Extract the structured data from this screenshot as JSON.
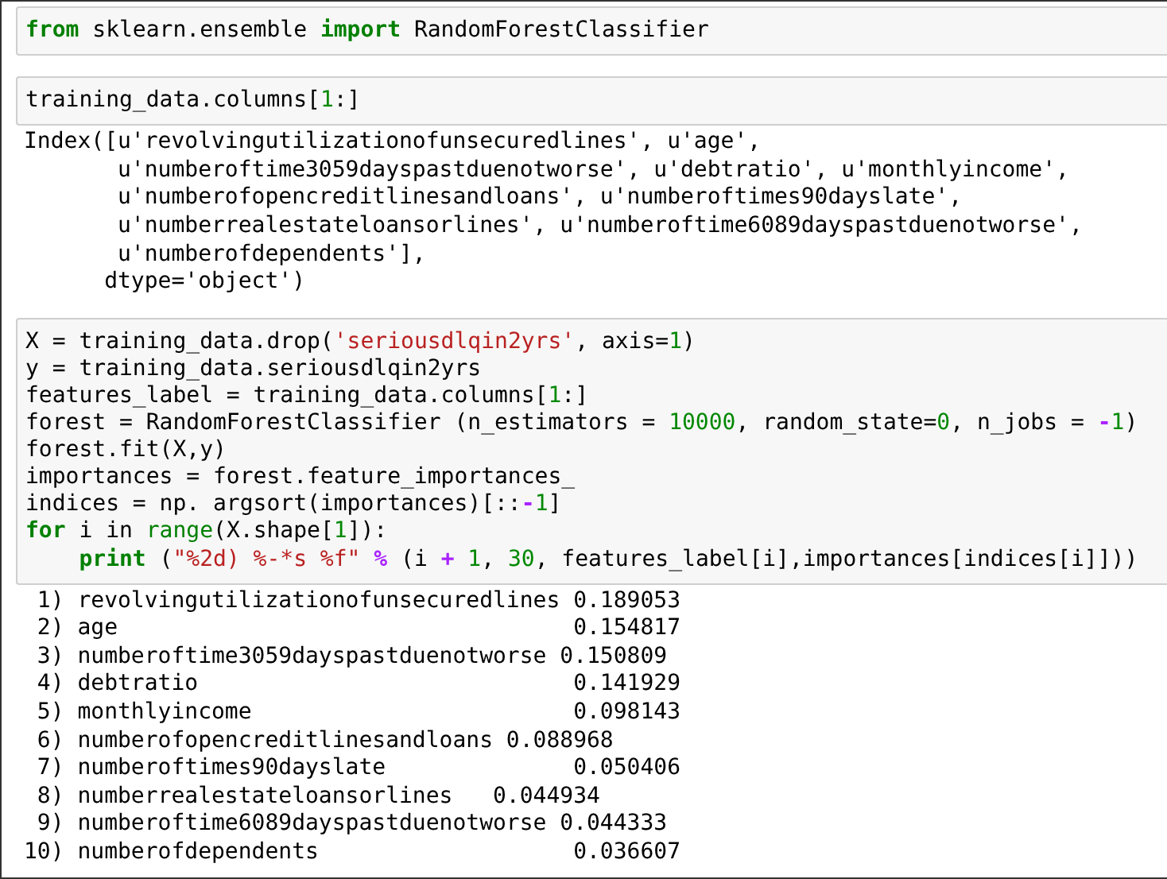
{
  "cells": [
    {
      "input": [
        [
          {
            "kind": "keyword",
            "text": "from"
          },
          {
            "kind": "plain",
            "text": " sklearn.ensemble "
          },
          {
            "kind": "keyword",
            "text": "import"
          },
          {
            "kind": "plain",
            "text": " RandomForestClassifier"
          }
        ]
      ]
    },
    {
      "input": [
        [
          {
            "kind": "plain",
            "text": "training_data.columns["
          },
          {
            "kind": "number",
            "text": "1"
          },
          {
            "kind": "plain",
            "text": ":]"
          }
        ]
      ],
      "output": [
        "Index([u'revolvingutilizationofunsecuredlines', u'age',",
        "       u'numberoftime3059dayspastduenotworse', u'debtratio', u'monthlyincome',",
        "       u'numberofopencreditlinesandloans', u'numberoftimes90dayslate',",
        "       u'numberrealestateloansorlines', u'numberoftime6089dayspastduenotworse',",
        "       u'numberofdependents'],",
        "      dtype='object')"
      ]
    },
    {
      "input": [
        [
          {
            "kind": "plain",
            "text": "X = training_data.drop("
          },
          {
            "kind": "string",
            "text": "'seriousdlqin2yrs'"
          },
          {
            "kind": "plain",
            "text": ", axis="
          },
          {
            "kind": "number",
            "text": "1"
          },
          {
            "kind": "plain",
            "text": ")"
          }
        ],
        [
          {
            "kind": "plain",
            "text": "y = training_data.seriousdlqin2yrs"
          }
        ],
        [
          {
            "kind": "plain",
            "text": "features_label = training_data.columns["
          },
          {
            "kind": "number",
            "text": "1"
          },
          {
            "kind": "plain",
            "text": ":]"
          }
        ],
        [
          {
            "kind": "plain",
            "text": "forest = RandomForestClassifier (n_estimators = "
          },
          {
            "kind": "number",
            "text": "10000"
          },
          {
            "kind": "plain",
            "text": ", random_state="
          },
          {
            "kind": "number",
            "text": "0"
          },
          {
            "kind": "plain",
            "text": ", n_jobs = "
          },
          {
            "kind": "operator",
            "text": "-"
          },
          {
            "kind": "number",
            "text": "1"
          },
          {
            "kind": "plain",
            "text": ")"
          }
        ],
        [
          {
            "kind": "plain",
            "text": "forest.fit(X,y)"
          }
        ],
        [
          {
            "kind": "plain",
            "text": "importances = forest.feature_importances_"
          }
        ],
        [
          {
            "kind": "plain",
            "text": "indices = np. argsort(importances)[::"
          },
          {
            "kind": "operator",
            "text": "-"
          },
          {
            "kind": "number",
            "text": "1"
          },
          {
            "kind": "plain",
            "text": "]"
          }
        ],
        [
          {
            "kind": "keyword",
            "text": "for"
          },
          {
            "kind": "plain",
            "text": " i in "
          },
          {
            "kind": "builtin",
            "text": "range"
          },
          {
            "kind": "plain",
            "text": "(X.shape["
          },
          {
            "kind": "number",
            "text": "1"
          },
          {
            "kind": "plain",
            "text": "]):"
          }
        ],
        [
          {
            "kind": "keyword",
            "text": "    print"
          },
          {
            "kind": "plain",
            "text": " ("
          },
          {
            "kind": "string",
            "text": "\"%2d) %-*s %f\""
          },
          {
            "kind": "operator",
            "text": " %"
          },
          {
            "kind": "plain",
            "text": " (i "
          },
          {
            "kind": "operator",
            "text": "+ "
          },
          {
            "kind": "number",
            "text": "1"
          },
          {
            "kind": "plain",
            "text": ", "
          },
          {
            "kind": "number",
            "text": "30"
          },
          {
            "kind": "plain",
            "text": ", features_label[i],importances[indices[i]]))"
          }
        ]
      ],
      "output": [
        " 1) revolvingutilizationofunsecuredlines 0.189053",
        " 2) age                                  0.154817",
        " 3) numberoftime3059dayspastduenotworse 0.150809",
        " 4) debtratio                            0.141929",
        " 5) monthlyincome                        0.098143",
        " 6) numberofopencreditlinesandloans 0.088968",
        " 7) numberoftimes90dayslate              0.050406",
        " 8) numberrealestateloansorlines   0.044934",
        " 9) numberoftime6089dayspastduenotworse 0.044333",
        "10) numberofdependents                   0.036607"
      ]
    }
  ]
}
